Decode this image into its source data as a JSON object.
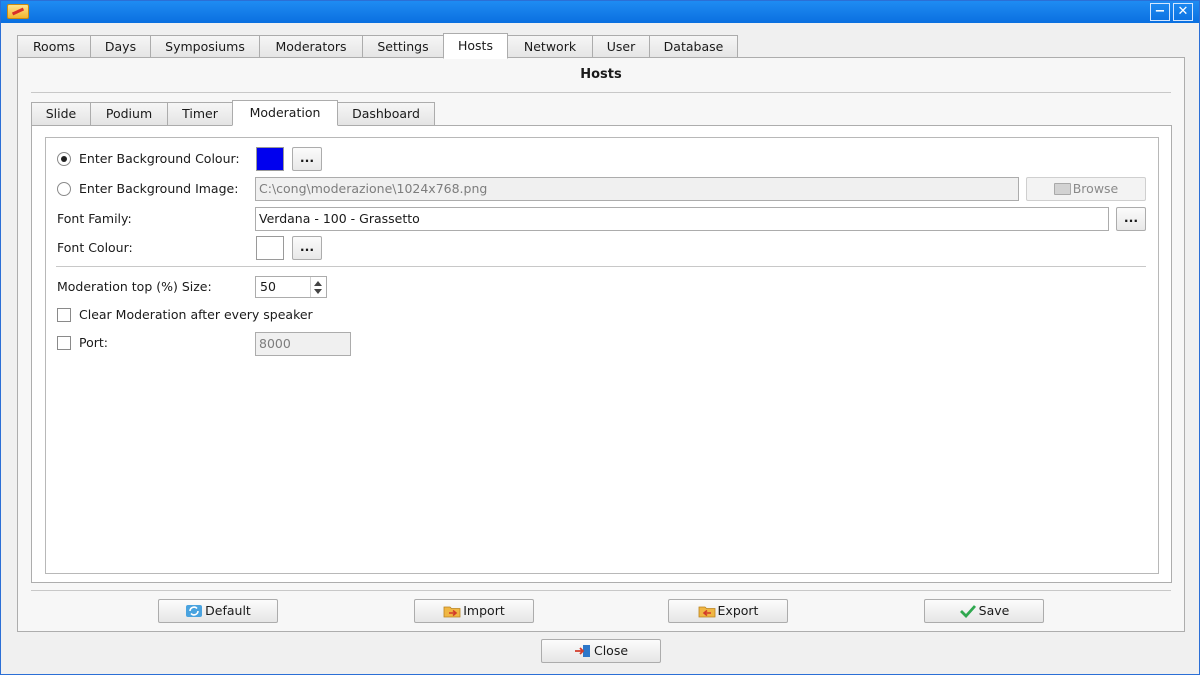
{
  "window": {
    "minimize_glyph": "−",
    "close_glyph": "✕"
  },
  "main_tabs": [
    {
      "label": "Rooms"
    },
    {
      "label": "Days"
    },
    {
      "label": "Symposiums"
    },
    {
      "label": "Moderators"
    },
    {
      "label": "Settings"
    },
    {
      "label": "Hosts",
      "active": true
    },
    {
      "label": "Network"
    },
    {
      "label": "User"
    },
    {
      "label": "Database"
    }
  ],
  "section_title": "Hosts",
  "sub_tabs": [
    {
      "label": "Slide"
    },
    {
      "label": "Podium"
    },
    {
      "label": "Timer"
    },
    {
      "label": "Moderation",
      "active": true
    },
    {
      "label": "Dashboard"
    }
  ],
  "moderation": {
    "bg_colour_label": "Enter Background Colour:",
    "bg_colour_selected": true,
    "bg_colour_value": "#0000ee",
    "bg_image_label": "Enter Background Image:",
    "bg_image_selected": false,
    "bg_image_path": "C:\\cong\\moderazione\\1024x768.png",
    "browse_label": "Browse",
    "font_family_label": "Font Family:",
    "font_family_value": "Verdana - 100 - Grassetto",
    "font_colour_label": "Font Colour:",
    "font_colour_value": "#ffffff",
    "dots_label": "...",
    "size_label": "Moderation top (%) Size:",
    "size_value": "50",
    "clear_label": "Clear Moderation after every speaker",
    "clear_checked": false,
    "port_label": "Port:",
    "port_checked": false,
    "port_value": "8000"
  },
  "actions": {
    "default_label": "Default",
    "import_label": "Import",
    "export_label": "Export",
    "save_label": "Save",
    "close_label": "Close"
  },
  "colors": {
    "titlebar": "#0a6fe0",
    "accent_green": "#2fa84f"
  }
}
